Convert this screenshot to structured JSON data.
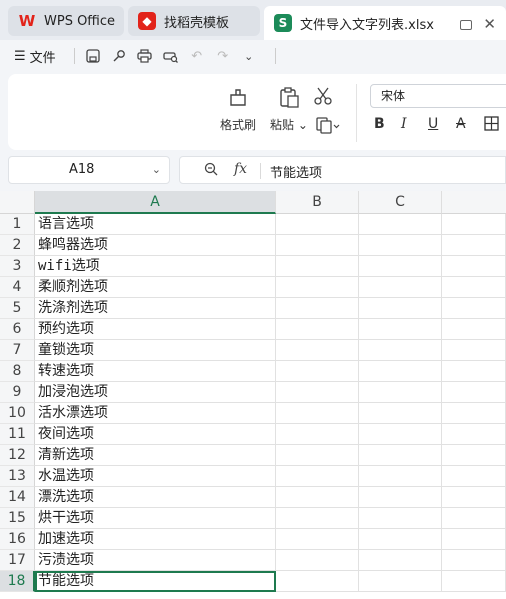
{
  "tabs": [
    {
      "label": "WPS Office",
      "icon": "wps-logo-icon"
    },
    {
      "label": "找稻壳模板",
      "icon": "daoke-icon"
    },
    {
      "label": "文件导入文字列表.xlsx",
      "icon": "spreadsheet-icon"
    }
  ],
  "menu": {
    "file_label": "文件"
  },
  "ribbon": {
    "format_painter": "格式刷",
    "paste": "粘贴",
    "font_name": "宋体"
  },
  "formula_bar": {
    "cell_ref": "A18",
    "fx": "fx",
    "content": "节能选项"
  },
  "columns": [
    "A",
    "B",
    "C"
  ],
  "rows": [
    {
      "num": "1",
      "a": "语言选项"
    },
    {
      "num": "2",
      "a": "蜂鸣器选项"
    },
    {
      "num": "3",
      "a": "wifi选项"
    },
    {
      "num": "4",
      "a": "柔顺剂选项"
    },
    {
      "num": "5",
      "a": "洗涤剂选项"
    },
    {
      "num": "6",
      "a": "预约选项"
    },
    {
      "num": "7",
      "a": "童锁选项"
    },
    {
      "num": "8",
      "a": "转速选项"
    },
    {
      "num": "9",
      "a": "加浸泡选项"
    },
    {
      "num": "10",
      "a": "活水漂选项"
    },
    {
      "num": "11",
      "a": "夜间选项"
    },
    {
      "num": "12",
      "a": "清新选项"
    },
    {
      "num": "13",
      "a": "水温选项"
    },
    {
      "num": "14",
      "a": "漂洗选项"
    },
    {
      "num": "15",
      "a": "烘干选项"
    },
    {
      "num": "16",
      "a": "加速选项"
    },
    {
      "num": "17",
      "a": "污渍选项"
    },
    {
      "num": "18",
      "a": "节能选项"
    }
  ],
  "colors": {
    "accent": "#1e7a4f",
    "wps_red": "#e2231a"
  }
}
